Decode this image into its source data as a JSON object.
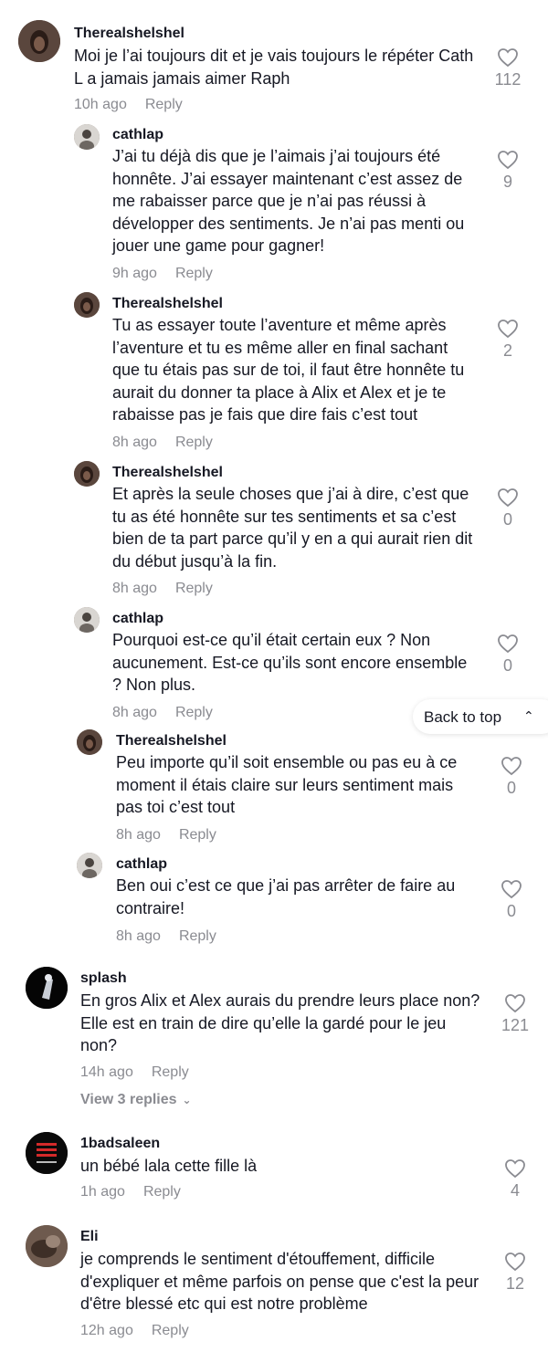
{
  "icons": {
    "like": "heart-outline-icon",
    "chevron": "chevron-down-icon",
    "back_to_top": "double-chevron-up-icon"
  },
  "colors": {
    "text": "#161823",
    "muted": "#8a8b91",
    "background": "#ffffff"
  },
  "back_to_top_label": "Back to top",
  "comments": [
    {
      "username": "Therealshelshel",
      "text": "Moi je l’ai toujours dit et je vais toujours le répéter Cath L a jamais jamais aimer Raph",
      "time": "10h ago",
      "reply": "Reply",
      "likes": "112"
    },
    {
      "username": "cathlap",
      "text": "J’ai tu déjà dis que je l’aimais j’ai toujours été honnête. J’ai essayer maintenant c’est assez de me rabaisser parce que je n’ai pas réussi à développer des sentiments. Je n’ai pas menti ou jouer une game pour gagner!",
      "time": "9h ago",
      "reply": "Reply",
      "likes": "9"
    },
    {
      "username": "Therealshelshel",
      "text": "Tu as essayer toute l’aventure et même après l’aventure et tu es même aller en final sachant que tu étais pas sur de toi, il faut être honnête tu aurait du donner ta place à Alix et Alex et je te rabaisse pas je fais que dire fais c’est tout",
      "time": "8h ago",
      "reply": "Reply",
      "likes": "2"
    },
    {
      "username": "Therealshelshel",
      "text": "Et après la seule choses que j’ai à dire, c’est que tu as été honnête sur tes sentiments et sa c’est bien de ta part parce qu’il y en a qui aurait rien dit du début jusqu’à la fin.",
      "time": "8h ago",
      "reply": "Reply",
      "likes": "0"
    },
    {
      "username": "cathlap",
      "text": "Pourquoi est-ce qu’il était certain eux ? Non aucunement. Est-ce qu’ils sont encore ensemble ? Non plus.",
      "time": "8h ago",
      "reply": "Reply",
      "likes": "0"
    },
    {
      "username": "Therealshelshel",
      "text": "Peu importe qu’il soit ensemble ou pas eu à ce moment il étais claire sur leurs sentiment mais pas toi c’est tout",
      "time": "8h ago",
      "reply": "Reply",
      "likes": "0"
    },
    {
      "username": "cathlap",
      "text": "Ben oui c’est ce que j’ai pas arrêter de faire au contraire!",
      "time": "8h ago",
      "reply": "Reply",
      "likes": "0"
    },
    {
      "username": "splash",
      "text": "En gros Alix et Alex aurais du prendre leurs place non? Elle est en train de dire qu’elle la gardé pour le jeu non?",
      "time": "14h ago",
      "reply": "Reply",
      "likes": "121",
      "view_replies": "View 3 replies"
    },
    {
      "username": "1badsaleen",
      "text": "un bébé lala cette fille là",
      "time": "1h ago",
      "reply": "Reply",
      "likes": "4"
    },
    {
      "username": "Eli",
      "text": "je comprends le sentiment d'étouffement, difficile d'expliquer et même parfois on pense que c'est la peur d'être blessé etc qui est notre problème",
      "time": "12h ago",
      "reply": "Reply",
      "likes": "12"
    }
  ]
}
